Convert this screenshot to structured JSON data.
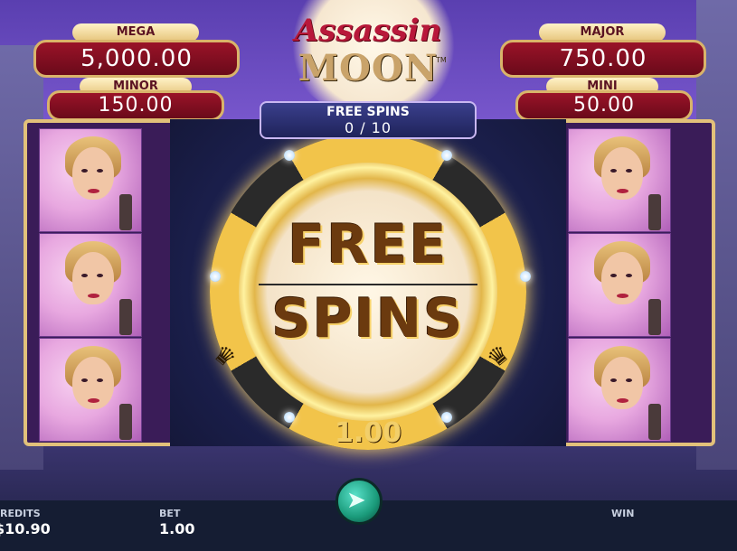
{
  "logo": {
    "line1": "Assassin",
    "line2": "MOON",
    "tm": "TM"
  },
  "jackpots": {
    "mega": {
      "label": "MEGA",
      "value": "5,000.00"
    },
    "minor": {
      "label": "MINOR",
      "value": "150.00"
    },
    "major": {
      "label": "MAJOR",
      "value": "750.00"
    },
    "mini": {
      "label": "MINI",
      "value": "50.00"
    }
  },
  "free_spins_banner": {
    "label": "FREE SPINS",
    "count": "0 / 10"
  },
  "chip": {
    "line1": "FREE",
    "line2": "SPINS",
    "bet": "1.00",
    "icons": [
      "gem-icon",
      "crown-icon"
    ]
  },
  "bottom_bar": {
    "credits_label": "REDITS",
    "credits_value": "$10.90",
    "bet_label": "BET",
    "bet_value": "1.00",
    "win_label": "WIN",
    "spin_icon": "spin-arrow-icon"
  },
  "colors": {
    "jackpot_red": "#9a1328",
    "gold": "#e2c17a",
    "panel_blue": "#1f235a",
    "spin_green": "#1a9a7a"
  }
}
